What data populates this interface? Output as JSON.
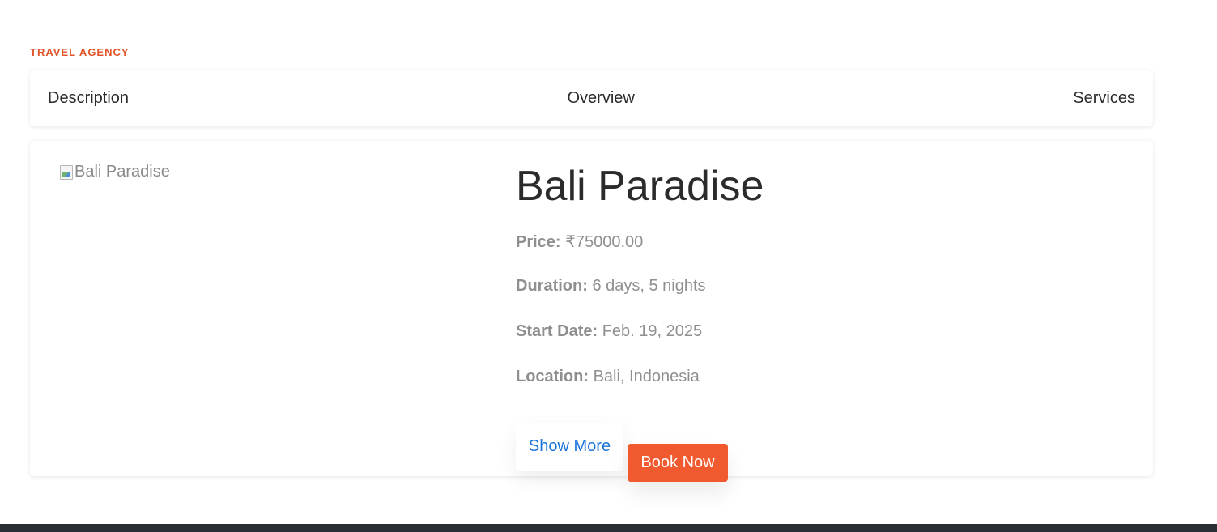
{
  "brand": {
    "eyebrow": "TRAVEL AGENCY"
  },
  "tabs": [
    {
      "label": "Description"
    },
    {
      "label": "Overview"
    },
    {
      "label": "Services"
    }
  ],
  "package": {
    "image_alt": "Bali Paradise",
    "title": "Bali Paradise",
    "price_label": "Price:",
    "price_value": "₹75000.00",
    "duration_label": "Duration:",
    "duration_value": "6 days, 5 nights",
    "start_label": "Start Date:",
    "start_value": "Feb. 19, 2025",
    "location_label": "Location:",
    "location_value": "Bali, Indonesia"
  },
  "actions": {
    "show_more": "Show More",
    "book_now": "Book Now"
  },
  "colors": {
    "accent": "#f05a2e",
    "eyebrow": "#e2552b",
    "link": "#1a73d9",
    "footer": "#2a2f36"
  }
}
